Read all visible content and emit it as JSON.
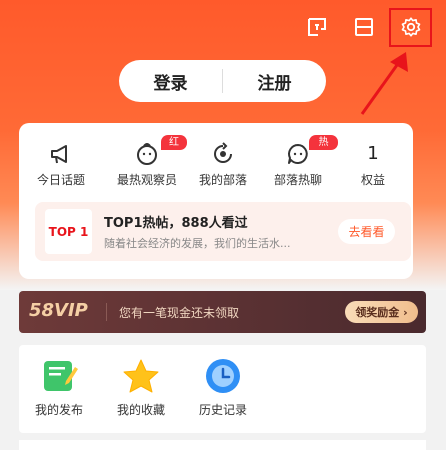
{
  "header": {
    "icons": [
      "scan-icon",
      "card-list-icon",
      "gear-icon"
    ],
    "login_label": "登录",
    "register_label": "注册"
  },
  "features": [
    {
      "label": "今日话题",
      "icon": "megaphone-icon",
      "badge": ""
    },
    {
      "label": "最热观察员",
      "icon": "face-icon",
      "badge": "红包"
    },
    {
      "label": "我的部落",
      "icon": "refresh-circle-icon",
      "badge": ""
    },
    {
      "label": "部落热聊",
      "icon": "chat-bubble-icon",
      "badge": "热门"
    },
    {
      "label": "权益",
      "icon": "",
      "badge": "",
      "value": "1"
    }
  ],
  "hot_post": {
    "thumb_text": "TOP 1",
    "title": "TOP1热帖，888人看过",
    "subtitle": "随着社会经济的发展，我们的生活水...",
    "button": "去看看"
  },
  "vip": {
    "logo": "58VIP",
    "text": "您有一笔现金还未领取",
    "button": "领奖励金 ›"
  },
  "tools": [
    {
      "label": "我的发布",
      "icon": "notepad-pencil-icon"
    },
    {
      "label": "我的收藏",
      "icon": "star-icon"
    },
    {
      "label": "历史记录",
      "icon": "clock-icon"
    }
  ],
  "colors": {
    "brand": "#ff5a2b",
    "highlight": "#e8141b",
    "badge": "#f4333c"
  }
}
